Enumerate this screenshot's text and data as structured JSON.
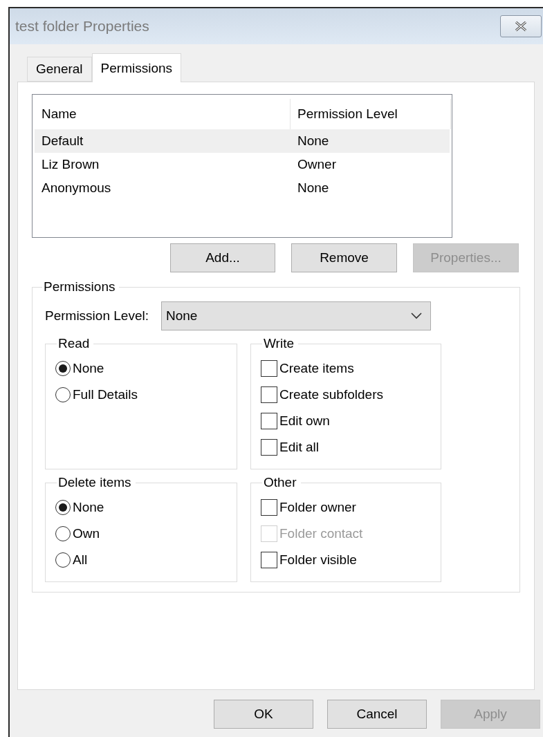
{
  "window": {
    "title": "test folder Properties"
  },
  "tabs": [
    {
      "label": "General",
      "selected": false
    },
    {
      "label": "Permissions",
      "selected": true
    }
  ],
  "user_list": {
    "columns": [
      "Name",
      "Permission Level"
    ],
    "rows": [
      {
        "name": "Default",
        "level": "None",
        "selected": true
      },
      {
        "name": "Liz Brown",
        "level": "Owner",
        "selected": false
      },
      {
        "name": "Anonymous",
        "level": "None",
        "selected": false
      }
    ]
  },
  "list_buttons": [
    {
      "label": "Add...",
      "disabled": false
    },
    {
      "label": "Remove",
      "disabled": false
    },
    {
      "label": "Properties...",
      "disabled": true
    }
  ],
  "permissions": {
    "title": "Permissions",
    "level_label": "Permission Level:",
    "level_value": "None",
    "groups": [
      {
        "title": "Read",
        "kind": "radio",
        "options": [
          {
            "label": "None",
            "selected": true
          },
          {
            "label": "Full Details",
            "selected": false
          }
        ]
      },
      {
        "title": "Write",
        "kind": "checkbox",
        "options": [
          {
            "label": "Create items",
            "checked": false,
            "disabled": false
          },
          {
            "label": "Create subfolders",
            "checked": false,
            "disabled": false
          },
          {
            "label": "Edit own",
            "checked": false,
            "disabled": false
          },
          {
            "label": "Edit all",
            "checked": false,
            "disabled": false
          }
        ]
      },
      {
        "title": "Delete items",
        "kind": "radio",
        "options": [
          {
            "label": "None",
            "selected": true
          },
          {
            "label": "Own",
            "selected": false
          },
          {
            "label": "All",
            "selected": false
          }
        ]
      },
      {
        "title": "Other",
        "kind": "checkbox",
        "options": [
          {
            "label": "Folder owner",
            "checked": false,
            "disabled": false
          },
          {
            "label": "Folder contact",
            "checked": false,
            "disabled": true
          },
          {
            "label": "Folder visible",
            "checked": false,
            "disabled": false
          }
        ]
      }
    ]
  },
  "dialog_buttons": [
    {
      "label": "OK",
      "disabled": false
    },
    {
      "label": "Cancel",
      "disabled": false
    },
    {
      "label": "Apply",
      "disabled": true
    }
  ]
}
